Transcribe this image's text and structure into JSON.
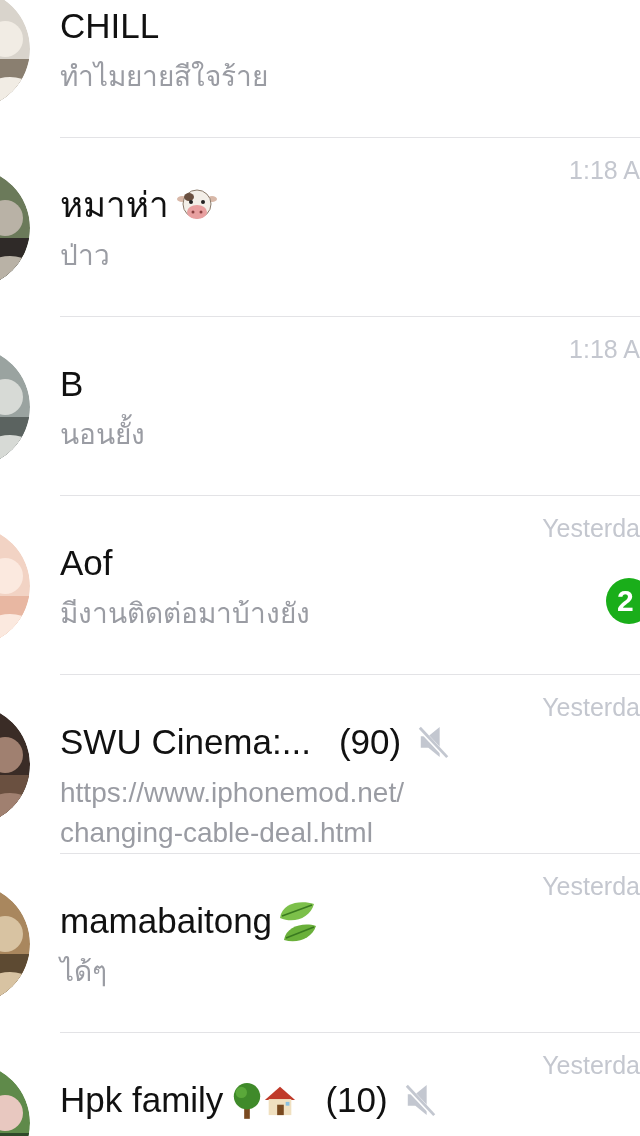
{
  "chats": [
    {
      "name": "CHILL",
      "preview": "ทำไมยายสีใจร้าย"
    },
    {
      "name": "หมาห่า",
      "name_icons": [
        {
          "kind": "cow"
        }
      ],
      "time": "1:18 A",
      "preview": "ป่าว"
    },
    {
      "name": "B",
      "time": "1:18 A",
      "preview": "นอนยั้ง"
    },
    {
      "name": "Aof",
      "time": "Yesterda",
      "preview": "มีงานติดต่อมาบ้างยัง",
      "unread": "2"
    },
    {
      "name": "SWU Cinema:...",
      "count": "(90)",
      "muted": true,
      "time": "Yesterda",
      "preview": "https://www.iphonemod.net/ changing-cable-deal.html"
    },
    {
      "name": "mamabaitong",
      "name_icons": [
        {
          "kind": "leaves"
        }
      ],
      "time": "Yesterda",
      "preview": "ได้ๆ"
    },
    {
      "name": "Hpk family",
      "name_icons": [
        {
          "kind": "tree"
        },
        {
          "kind": "house"
        }
      ],
      "count": "(10)",
      "muted": true,
      "time": "Yesterda"
    }
  ]
}
